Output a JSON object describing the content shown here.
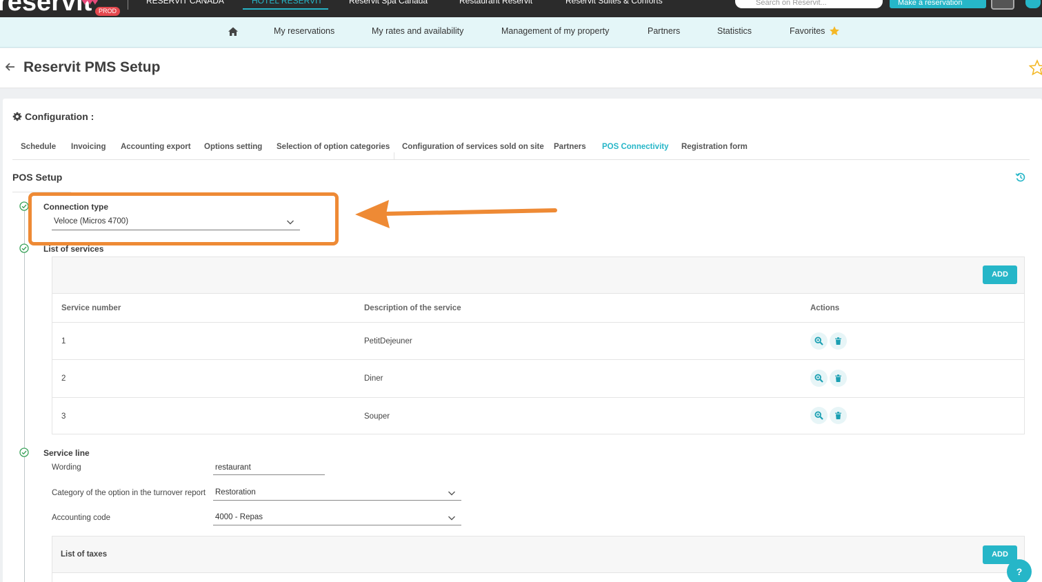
{
  "topbar": {
    "logo": "reservit",
    "badge": "PROD",
    "tabs": [
      "RESERVIT CANADA",
      "HOTEL RESERVIT",
      "Reservit Spa Canada",
      "Restaurant Reservit",
      "Reservit Suites & Conforts"
    ],
    "active_tab": 1,
    "search_placeholder": "Search on Reservit...",
    "cta_label": "Make a reservation"
  },
  "nav": {
    "items": [
      "My reservations",
      "My rates and availability",
      "Management of my property",
      "Partners",
      "Statistics",
      "Favorites"
    ]
  },
  "page": {
    "title": "Reservit PMS Setup"
  },
  "config": {
    "heading": "Configuration :",
    "tabs": [
      "Schedule",
      "Invoicing",
      "Accounting export",
      "Options setting",
      "Selection of option categories",
      "Configuration of services sold on site",
      "Partners",
      "POS Connectivity",
      "Registration form"
    ],
    "active_tab": "POS Connectivity"
  },
  "pos": {
    "title": "POS Setup",
    "connection_type_label": "Connection type",
    "connection_type_value": "Veloce (Micros 4700)",
    "services_label": "List of services",
    "add_label": "ADD",
    "columns": [
      "Service number",
      "Description of the service",
      "Actions"
    ],
    "services": [
      {
        "number": "1",
        "description": "PetitDejeuner"
      },
      {
        "number": "2",
        "description": "Diner"
      },
      {
        "number": "3",
        "description": "Souper"
      }
    ],
    "service_line_label": "Service line",
    "wording_label": "Wording",
    "wording_value": "restaurant",
    "category_label": "Category of the option in the turnover report",
    "category_value": "Restoration",
    "accounting_label": "Accounting code",
    "accounting_value": "4000 - Repas",
    "taxes_label": "List of taxes",
    "taxes_add_label": "ADD"
  },
  "help_label": "?",
  "colors": {
    "accent": "#26b6c8",
    "annotation": "#ee8a35",
    "check": "#3aa25a",
    "star": "#f4b826"
  }
}
